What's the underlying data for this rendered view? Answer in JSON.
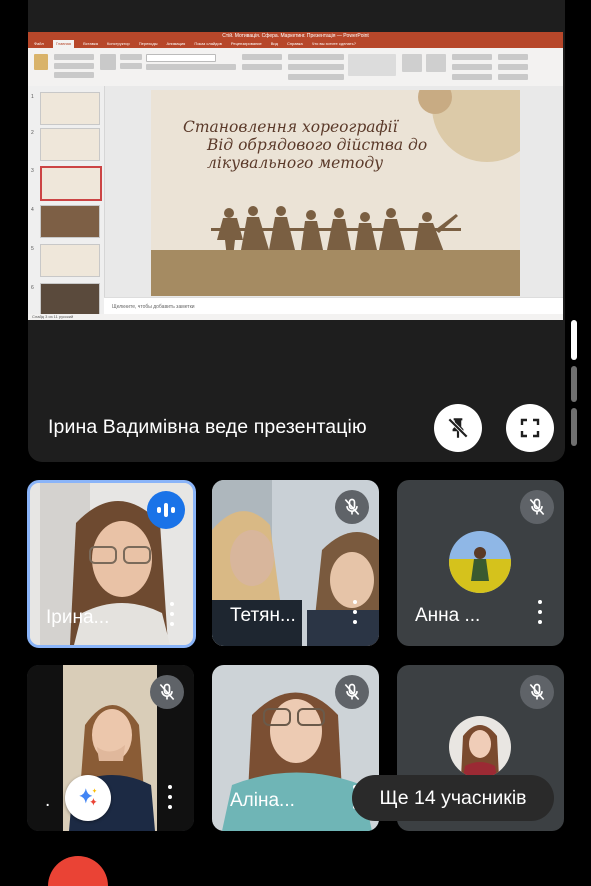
{
  "presentation": {
    "window_title": "Стій. Мотивація. Сфера. Маркетинг. Презентація — PowerPoint",
    "tabs": [
      "Файл",
      "Главная",
      "Вставка",
      "Конструктор",
      "Переходы",
      "Анимация",
      "Показ слайдов",
      "Рецензирование",
      "Вид",
      "Справка",
      "Что вы хотите сделать?"
    ],
    "slide_title_lines": [
      "Становлення хореографії",
      "Від обрядового дійства до",
      "лікувального методу"
    ],
    "notes_placeholder": "Щелкните, чтобы добавить заметки",
    "status_text": "Слайд 3 из 11   русский",
    "thumb_numbers": [
      "1",
      "2",
      "3",
      "4",
      "5",
      "6"
    ]
  },
  "presenter_label": "Ірина Вадимівна веде презентацію",
  "participants": [
    {
      "name": "Ірина...",
      "state": "speaking"
    },
    {
      "name": "Тетян...",
      "state": "muted"
    },
    {
      "name": "Анна ...",
      "state": "muted"
    },
    {
      "name": ".",
      "state": "muted"
    },
    {
      "name": "Аліна...",
      "state": "muted"
    },
    {
      "name": "",
      "state": "muted"
    }
  ],
  "more_participants": "Ще 14 учасників",
  "colors": {
    "ppt_accent": "#b7472a",
    "active_speaker_border": "#8ab4f8",
    "speaking_badge": "#1a73e8",
    "tile_bg": "#3c4043"
  },
  "icons": [
    "unpin-icon",
    "fullscreen-icon",
    "mic-off-icon",
    "speaking-indicator-icon",
    "more-vert-icon",
    "gemini-sparkle-icon"
  ]
}
